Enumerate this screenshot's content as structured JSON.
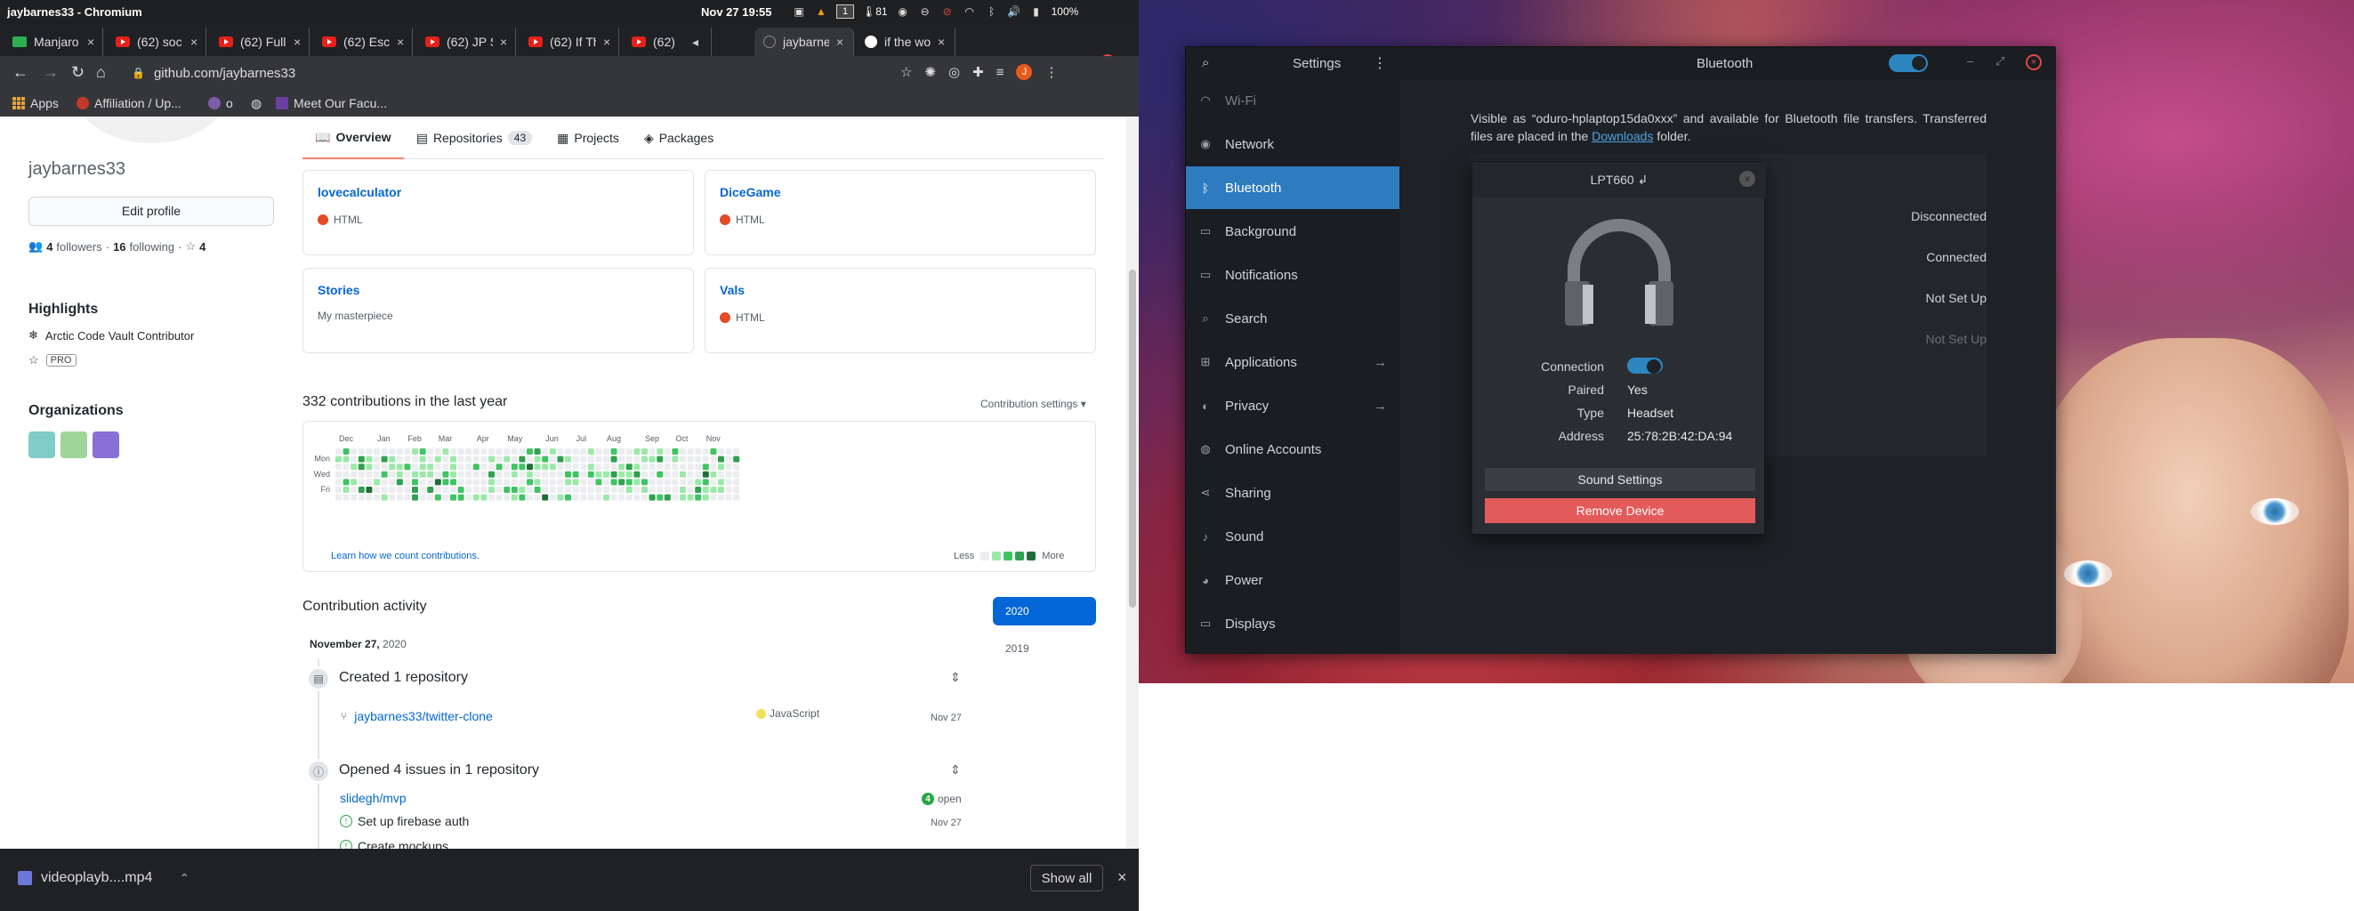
{
  "topbar": {
    "window_title": "jaybarnes33 - Chromium",
    "clock": "Nov 27  19:55",
    "workspace": "1",
    "temp": "81",
    "battery": "100%"
  },
  "tabs": [
    {
      "label": "Manjaro",
      "icon": "manjaro-icon"
    },
    {
      "label": "(62) soc",
      "icon": "youtube-icon"
    },
    {
      "label": "(62) Full",
      "icon": "youtube-icon"
    },
    {
      "label": "(62) Esc",
      "icon": "youtube-icon"
    },
    {
      "label": "(62) JP S",
      "icon": "youtube-icon"
    },
    {
      "label": "(62) If Th",
      "icon": "youtube-icon"
    },
    {
      "label": "(62)",
      "icon": "youtube-icon"
    },
    {
      "label": "jaybarnes",
      "icon": "github-icon"
    },
    {
      "label": "if the wo",
      "icon": "google-icon"
    }
  ],
  "address": "github.com/jaybarnes33",
  "bookmarks": {
    "apps": "Apps",
    "affiliation": "Affiliation / Up...",
    "o": "o",
    "meet": "Meet Our Facu..."
  },
  "profile": {
    "username": "jaybarnes33",
    "edit_label": "Edit profile",
    "followers_count": "4",
    "followers_label": "followers",
    "following_count": "16",
    "following_label": "following",
    "stars": "4",
    "highlights_title": "Highlights",
    "highlight_1": "Arctic Code Vault Contributor",
    "highlight_2": "PRO",
    "orgs_title": "Organizations"
  },
  "nav": {
    "overview": "Overview",
    "repositories": "Repositories",
    "repo_count": "43",
    "projects": "Projects",
    "packages": "Packages"
  },
  "pinned": [
    {
      "name": "lovecalculator",
      "desc": "",
      "lang": "HTML",
      "lang_color": "#e34c26"
    },
    {
      "name": "DiceGame",
      "desc": "",
      "lang": "HTML",
      "lang_color": "#e34c26"
    },
    {
      "name": "Stories",
      "desc": "My masterpiece",
      "lang": "",
      "lang_color": ""
    },
    {
      "name": "Vals",
      "desc": "",
      "lang": "HTML",
      "lang_color": "#e34c26"
    }
  ],
  "contributions": {
    "title": "332 contributions in the last year",
    "settings": "Contribution settings ▾",
    "months": [
      "Dec",
      "Jan",
      "Feb",
      "Mar",
      "Apr",
      "May",
      "Jun",
      "Jul",
      "Aug",
      "Sep",
      "Oct",
      "Nov"
    ],
    "days": [
      "Mon",
      "Wed",
      "Fri"
    ],
    "learn": "Learn how we count contributions.",
    "less": "Less",
    "more": "More",
    "colors": [
      "#ebedf0",
      "#9be9a8",
      "#40c463",
      "#30a14e",
      "#216e39"
    ]
  },
  "activity": {
    "title": "Contribution activity",
    "year_selected": "2020",
    "year_other": "2019",
    "month": "November 27,",
    "month_year": "2020",
    "created_title": "Created 1 repository",
    "created_repo": "jaybarnes33/twitter-clone",
    "created_lang": "JavaScript",
    "created_date": "Nov 27",
    "issues_title": "Opened 4 issues in 1 repository",
    "issues_repo": "slidegh/mvp",
    "issues_open_count": "4",
    "issues_open_label": "open",
    "issue_1": "Set up firebase auth",
    "issue_1_date": "Nov 27",
    "issue_2": "Create mockups"
  },
  "downloads": {
    "file": "videoplayb....mp4",
    "show_all": "Show all"
  },
  "settings": {
    "title": "Settings",
    "page_title": "Bluetooth",
    "sidebar": [
      {
        "label": "Wi-Fi",
        "icon": "wifi-icon",
        "arrow": false
      },
      {
        "label": "Network",
        "icon": "network-icon",
        "arrow": false
      },
      {
        "label": "Bluetooth",
        "icon": "bluetooth-icon",
        "arrow": false
      },
      {
        "label": "Background",
        "icon": "background-icon",
        "arrow": false
      },
      {
        "label": "Notifications",
        "icon": "notifications-icon",
        "arrow": false
      },
      {
        "label": "Search",
        "icon": "search-icon",
        "arrow": false
      },
      {
        "label": "Applications",
        "icon": "applications-icon",
        "arrow": true
      },
      {
        "label": "Privacy",
        "icon": "privacy-icon",
        "arrow": true
      },
      {
        "label": "Online Accounts",
        "icon": "online-accounts-icon",
        "arrow": false
      },
      {
        "label": "Sharing",
        "icon": "sharing-icon",
        "arrow": false
      },
      {
        "label": "Sound",
        "icon": "sound-icon",
        "arrow": false
      },
      {
        "label": "Power",
        "icon": "power-icon",
        "arrow": false
      },
      {
        "label": "Displays",
        "icon": "displays-icon",
        "arrow": false
      }
    ],
    "visible_text_1": "Visible as “oduro-hplaptop15da0xxx” and available for Bluetooth file transfers. Transferred files are placed in the ",
    "downloads_link": "Downloads",
    "visible_text_2": " folder.",
    "device_statuses": [
      "Disconnected",
      "Connected",
      "Not Set Up",
      "Not Set Up"
    ]
  },
  "device": {
    "name": "LPT660 ↲",
    "connection_label": "Connection",
    "paired_label": "Paired",
    "paired_value": "Yes",
    "type_label": "Type",
    "type_value": "Headset",
    "address_label": "Address",
    "address_value": "25:78:2B:42:DA:94",
    "sound_settings": "Sound Settings",
    "remove": "Remove Device"
  }
}
